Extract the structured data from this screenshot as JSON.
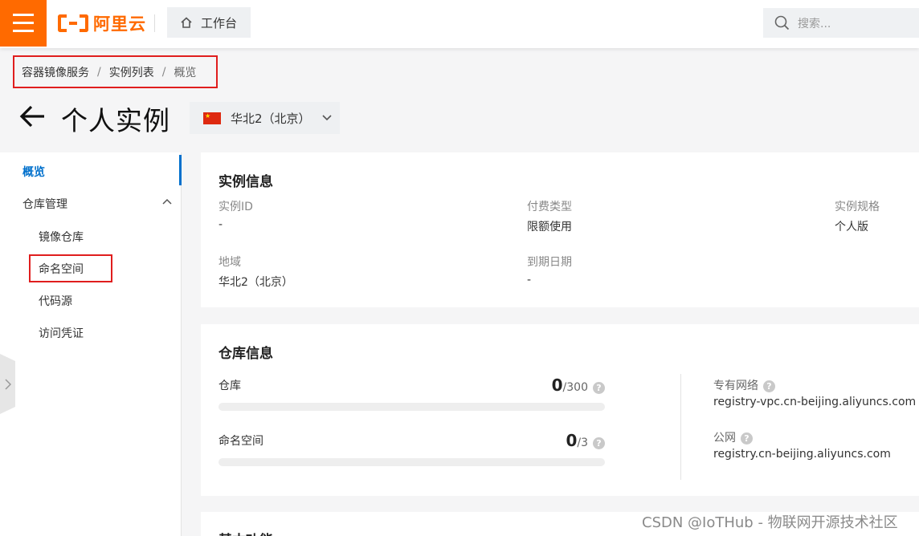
{
  "brand": {
    "name": "阿里云",
    "color": "#ff6a00"
  },
  "topbar": {
    "menu_icon": "hamburger-icon",
    "workbench_label": "工作台",
    "search_placeholder": "搜索..."
  },
  "breadcrumb": {
    "items": [
      "容器镜像服务",
      "实例列表",
      "概览"
    ]
  },
  "page": {
    "title": "个人实例",
    "region": "华北2（北京）",
    "region_flag": "china-flag-icon"
  },
  "sidebar": {
    "overview": "概览",
    "group": "仓库管理",
    "items": [
      "镜像仓库",
      "命名空间",
      "代码源",
      "访问凭证"
    ],
    "active_color": "#0070cc"
  },
  "instance_info": {
    "title": "实例信息",
    "fields": [
      {
        "label": "实例ID",
        "value": "-"
      },
      {
        "label": "付费类型",
        "value": "限额使用"
      },
      {
        "label": "实例规格",
        "value": "个人版"
      },
      {
        "label": "地域",
        "value": "华北2（北京）"
      },
      {
        "label": "到期日期",
        "value": "-"
      }
    ]
  },
  "repo_info": {
    "title": "仓库信息",
    "repo": {
      "label": "仓库",
      "used": "0",
      "quota": "/300",
      "fraction": 0
    },
    "namespace": {
      "label": "命名空间",
      "used": "0",
      "quota": "/3",
      "fraction": 0
    },
    "vpc": {
      "label": "专有网络",
      "value": "registry-vpc.cn-beijing.aliyuncs.com"
    },
    "public": {
      "label": "公网",
      "value": "registry.cn-beijing.aliyuncs.com"
    }
  },
  "basic_features": {
    "title": "基本功能"
  },
  "watermark": "CSDN @IoTHub - 物联网开源技术社区",
  "highlight_color": "#e01e1e"
}
